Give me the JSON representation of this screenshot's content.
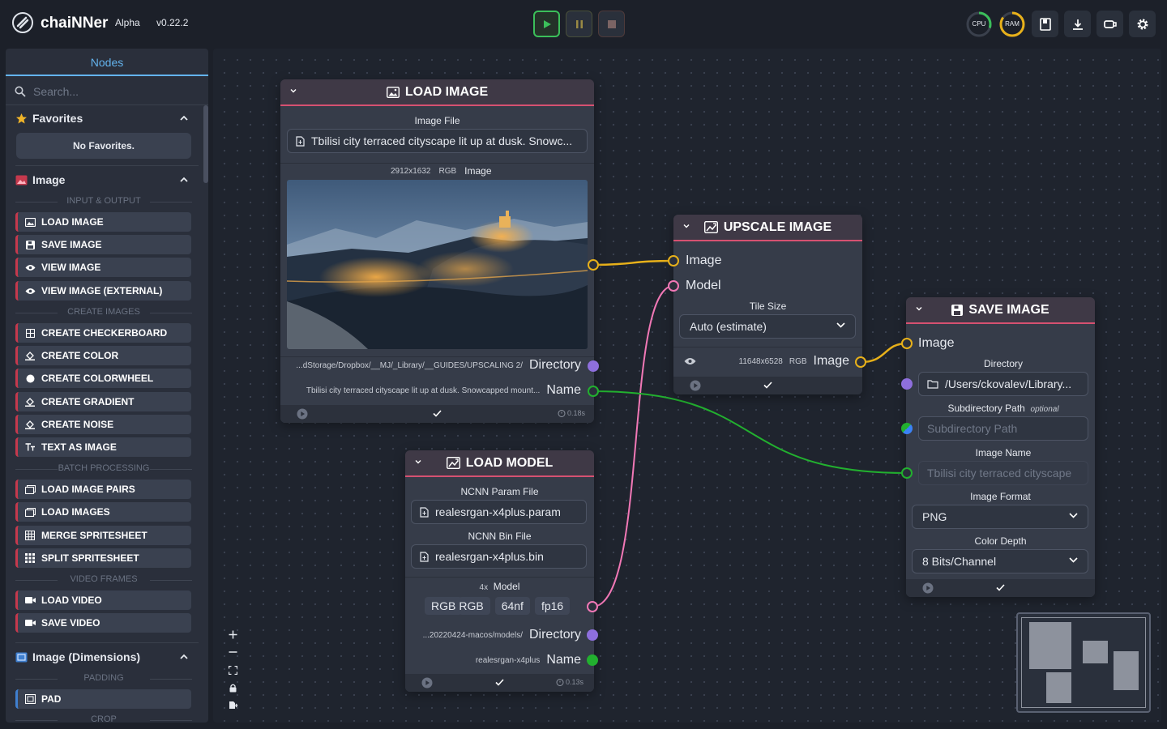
{
  "header": {
    "app_name": "chaiNNer",
    "channel": "Alpha",
    "version": "v0.22.2",
    "cpu_label": "CPU",
    "ram_label": "RAM",
    "cpu_usage_pct": 30,
    "ram_usage_pct": 85
  },
  "sidebar": {
    "tab_label": "Nodes",
    "search_placeholder": "Search...",
    "favorites_title": "Favorites",
    "favorites_empty": "No Favorites.",
    "image_title": "Image",
    "sub_input_output": "INPUT & OUTPUT",
    "sub_create_images": "CREATE IMAGES",
    "sub_batch": "BATCH PROCESSING",
    "sub_video": "VIDEO FRAMES",
    "dimensions_title": "Image (Dimensions)",
    "sub_padding": "PADDING",
    "sub_crop": "CROP",
    "items": [
      {
        "label": "LOAD IMAGE",
        "icon": "image-icon"
      },
      {
        "label": "SAVE IMAGE",
        "icon": "floppy-icon"
      },
      {
        "label": "VIEW IMAGE",
        "icon": "eye-icon"
      },
      {
        "label": "VIEW IMAGE (EXTERNAL)",
        "icon": "eye-icon"
      },
      {
        "label": "CREATE CHECKERBOARD",
        "icon": "grid-icon"
      },
      {
        "label": "CREATE COLOR",
        "icon": "paint-bucket-icon"
      },
      {
        "label": "CREATE COLORWHEEL",
        "icon": "circle-icon"
      },
      {
        "label": "CREATE GRADIENT",
        "icon": "paint-bucket-icon"
      },
      {
        "label": "CREATE NOISE",
        "icon": "paint-bucket-icon"
      },
      {
        "label": "TEXT AS IMAGE",
        "icon": "text-icon"
      },
      {
        "label": "LOAD IMAGE PAIRS",
        "icon": "images-icon"
      },
      {
        "label": "LOAD IMAGES",
        "icon": "images-icon"
      },
      {
        "label": "MERGE SPRITESHEET",
        "icon": "grid-icon"
      },
      {
        "label": "SPLIT SPRITESHEET",
        "icon": "grid-dots-icon"
      },
      {
        "label": "LOAD VIDEO",
        "icon": "video-icon"
      },
      {
        "label": "SAVE VIDEO",
        "icon": "video-icon"
      },
      {
        "label": "PAD",
        "icon": "grid-icon"
      }
    ]
  },
  "nodes": {
    "load_image": {
      "title": "LOAD IMAGE",
      "file_label": "Image File",
      "file_value": "Tbilisi city terraced cityscape lit up at dusk. Snowc...",
      "dims": "2912x1632",
      "channels": "RGB",
      "out_image": "Image",
      "dir_value": "...dStorage/Dropbox/__MJ/_Library/__GUIDES/UPSCALING 2/",
      "out_directory": "Directory",
      "name_value": "Tbilisi city terraced cityscape lit up at dusk. Snowcapped mount...",
      "out_name": "Name",
      "time": "0.18s"
    },
    "upscale": {
      "title": "UPSCALE IMAGE",
      "in_image": "Image",
      "in_model": "Model",
      "tile_label": "Tile Size",
      "tile_value": "Auto (estimate)",
      "dims": "11648x6528",
      "channels": "RGB",
      "out_image": "Image"
    },
    "load_model": {
      "title": "LOAD MODEL",
      "param_label": "NCNN Param File",
      "param_value": "realesrgan-x4plus.param",
      "bin_label": "NCNN Bin File",
      "bin_value": "realesrgan-x4plus.bin",
      "scale": "4x",
      "model_label": "Model",
      "tags": [
        "RGB",
        "RGB",
        "64nf",
        "fp16"
      ],
      "dir_value": "...20220424-macos/models/",
      "out_directory": "Directory",
      "name_value": "realesrgan-x4plus",
      "out_name": "Name",
      "time": "0.13s"
    },
    "save_image": {
      "title": "SAVE IMAGE",
      "in_image": "Image",
      "dir_label": "Directory",
      "dir_value": "/Users/ckovalev/Library...",
      "subdir_label": "Subdirectory Path",
      "optional": "optional",
      "subdir_placeholder": "Subdirectory Path",
      "name_label": "Image Name",
      "name_value": "Tbilisi city terraced cityscape",
      "format_label": "Image Format",
      "format_value": "PNG",
      "depth_label": "Color Depth",
      "depth_value": "8 Bits/Channel"
    }
  },
  "colors": {
    "image_edge": "#e8b11a",
    "model_edge": "#f178b6",
    "text_edge": "#22b02f",
    "directory_handle": "#8e6fdd",
    "accent": "#63b3ed"
  }
}
